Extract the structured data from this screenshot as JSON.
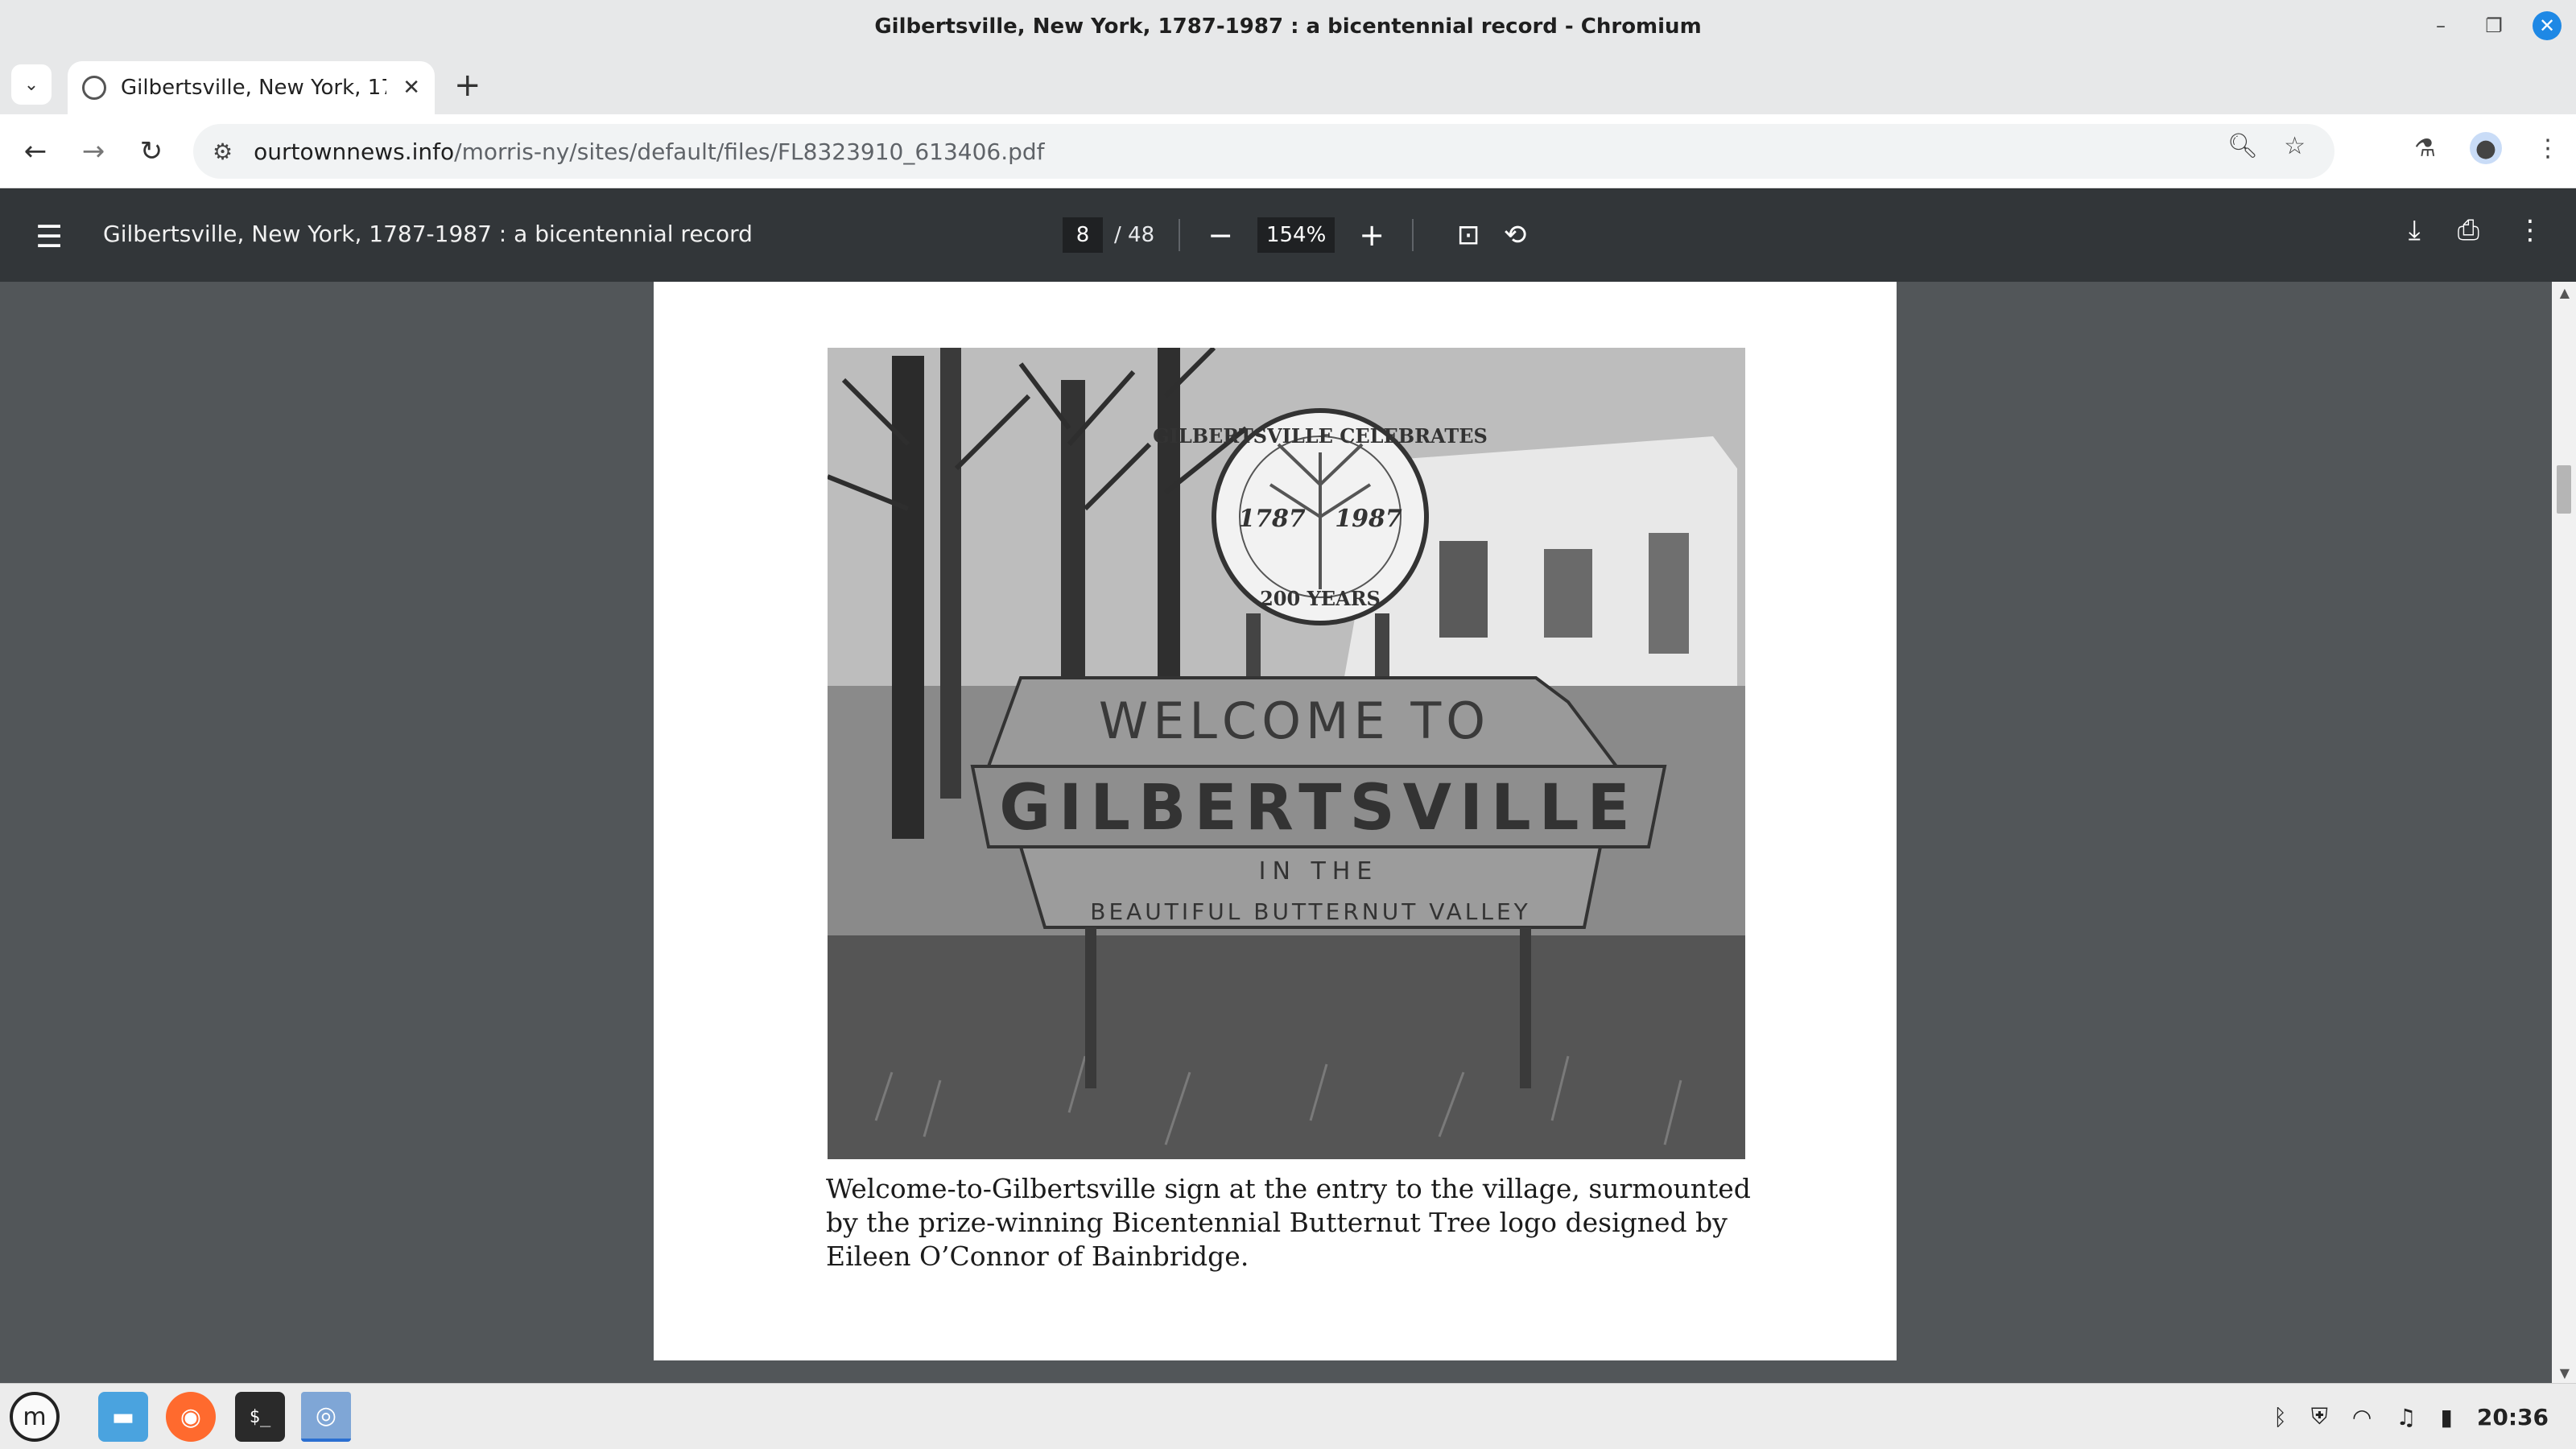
{
  "window": {
    "title": "Gilbertsville, New York, 1787-1987 : a bicentennial record - Chromium"
  },
  "tab": {
    "title": "Gilbertsville, New York, 1787-1987 : a bicentennial record"
  },
  "address_bar": {
    "domain": "ourtownnews.info",
    "path": "/morris-ny/sites/default/files/FL8323910_613406.pdf"
  },
  "pdf_toolbar": {
    "title": "Gilbertsville, New York, 1787-1987 : a bicentennial record",
    "page_current": "8",
    "page_total": "/ 48",
    "zoom": "154%"
  },
  "page": {
    "sign_text": {
      "seal_top": "GILBERTSVILLE CELEBRATES",
      "year_left": "1787",
      "year_right": "1987",
      "seal_bottom": "200 YEARS",
      "welcome": "WELCOME TO",
      "name": "GILBERTSVILLE",
      "in_the": "IN THE",
      "valley": "BEAUTIFUL BUTTERNUT VALLEY"
    },
    "caption": "Welcome-to-Gilbertsville sign at the entry to the village, surmounted by the prize-winning Bicentennial Butternut Tree logo designed by Eileen O’Connor of Bainbridge."
  },
  "taskbar": {
    "clock": "20:36"
  },
  "icons": {
    "tab_search": "chevron-down-icon",
    "back": "arrow-left-icon",
    "forward": "arrow-right-icon",
    "reload": "reload-icon",
    "site_info": "tune-icon",
    "zoom": "zoom-icon",
    "bookmark": "star-icon",
    "labs": "flask-icon",
    "profile": "person-icon",
    "menu": "kebab-icon"
  }
}
